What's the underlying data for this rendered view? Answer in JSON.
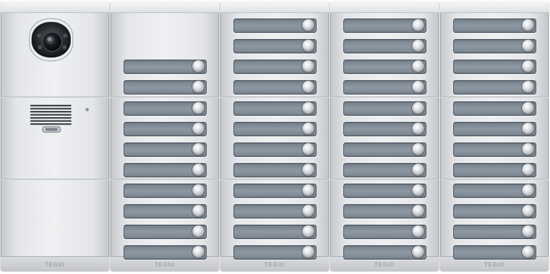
{
  "brand": "TEGUI",
  "modules": [
    {
      "type": "camera-speaker",
      "brand": "TEGUI"
    },
    {
      "type": "buttons",
      "count": 10,
      "brand": "TEGUI"
    },
    {
      "type": "buttons",
      "count": 12,
      "brand": "TEGUI"
    },
    {
      "type": "buttons",
      "count": 12,
      "brand": "TEGUI"
    },
    {
      "type": "buttons",
      "count": 12,
      "brand": "TEGUI"
    }
  ],
  "icons": [
    "camera-icon",
    "speaker-grille-icon",
    "led-indicator-icon",
    "call-button-icon"
  ]
}
